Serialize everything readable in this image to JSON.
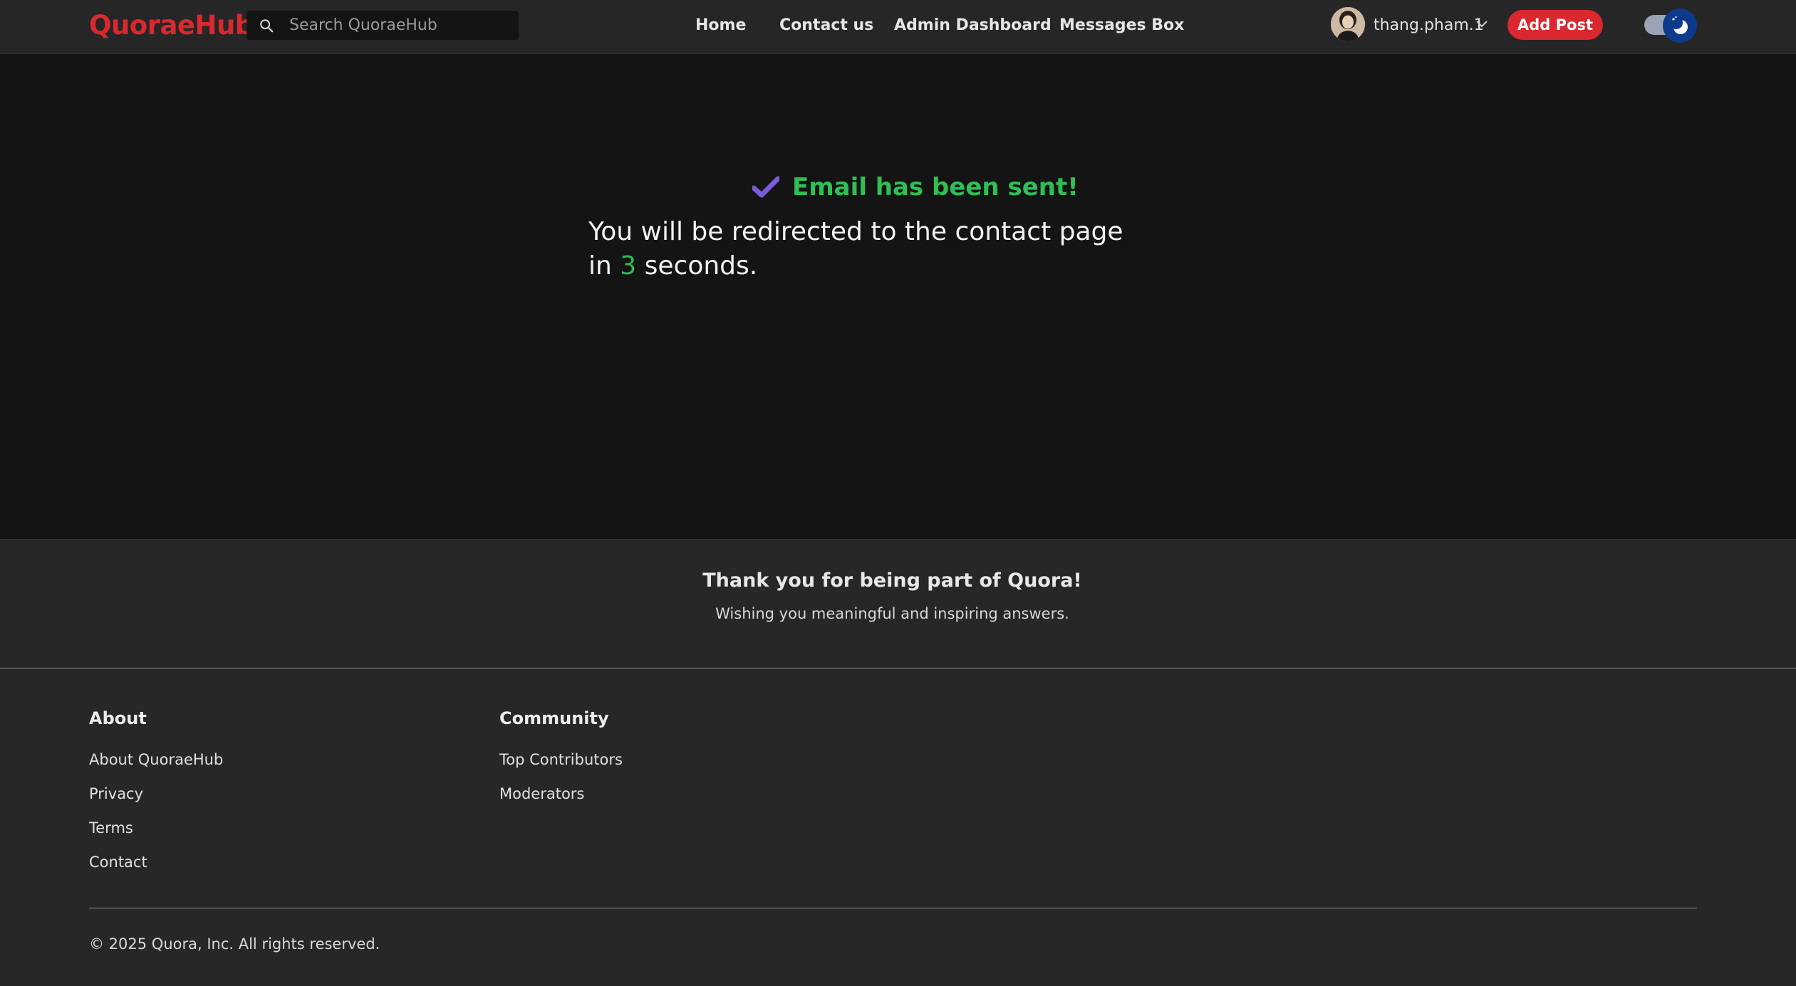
{
  "header": {
    "logo": "QuoraeHub",
    "search_placeholder": "Search QuoraeHub",
    "nav": [
      "Home",
      "Contact us",
      "Admin Dashboard",
      "Messages Box"
    ],
    "username": "thang.pham.1",
    "add_post_label": "Add Post",
    "theme": "dark"
  },
  "main": {
    "success_title": "Email has been sent!",
    "redirect_prefix": "You will be redirected to the contact page in ",
    "countdown": "3",
    "redirect_suffix": " seconds."
  },
  "thanks": {
    "title": "Thank you for being part of Quora!",
    "subtitle": "Wishing you meaningful and inspiring answers."
  },
  "footer": {
    "about": {
      "heading": "About",
      "links": [
        "About QuoraeHub",
        "Privacy",
        "Terms",
        "Contact"
      ]
    },
    "community": {
      "heading": "Community",
      "links": [
        "Top Contributors",
        "Moderators"
      ]
    },
    "copyright": "© 2025 Quora, Inc. All rights reserved."
  },
  "colors": {
    "brand": "#d9282f",
    "success": "#2fbf54",
    "check": "#7b5cd6",
    "background": "#141414",
    "surface": "#262626"
  }
}
